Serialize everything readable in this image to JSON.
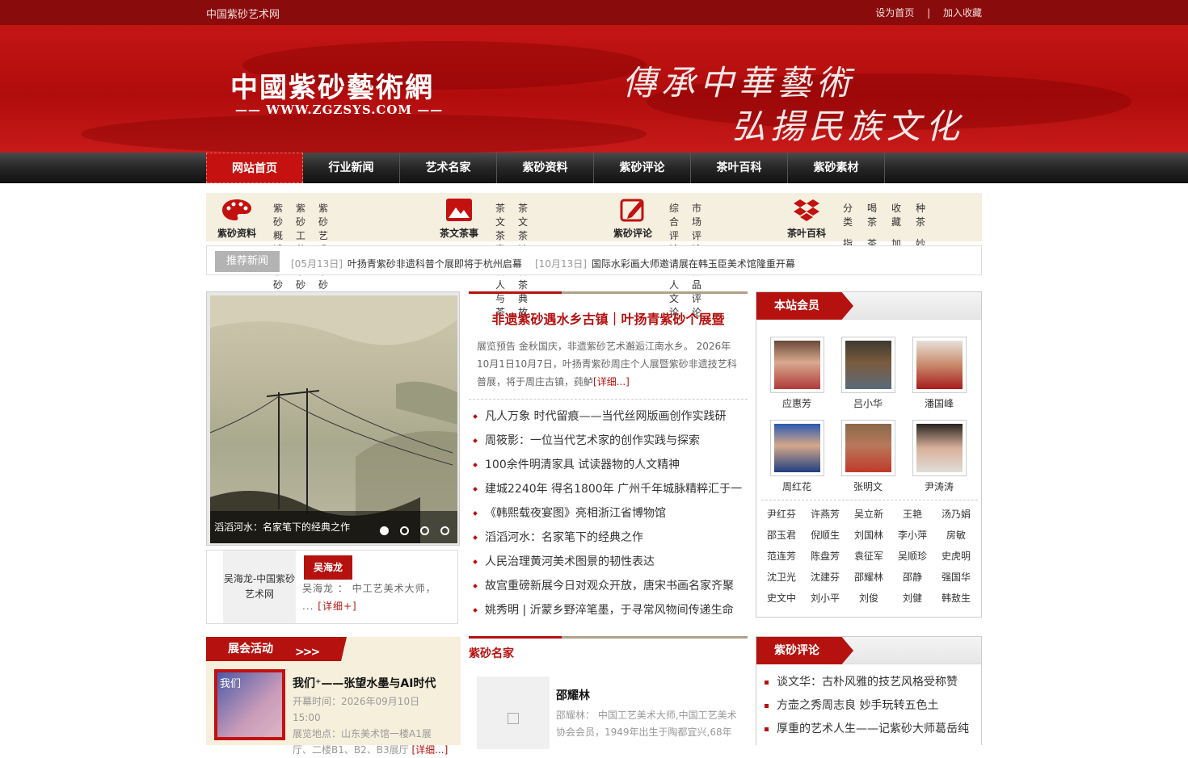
{
  "topbar": {
    "site_name": "中国紫砂艺术网",
    "set_home": "设为首页",
    "separator": "|",
    "add_favorite": "加入收藏"
  },
  "banner": {
    "logo_cn": "中國紫砂藝術網",
    "logo_en": "—— WWW.ZGZSYS.COM ——",
    "slogan_line1": "傳承中華藝術",
    "slogan_line2": "弘揚民族文化"
  },
  "nav": {
    "items": [
      "网站首页",
      "行业新闻",
      "艺术名家",
      "紫砂资料",
      "紫砂评论",
      "茶叶百科",
      "紫砂素材"
    ],
    "active": "网站首页"
  },
  "categories": [
    {
      "label": "紫砂资料",
      "icon": "palette-icon",
      "links": [
        "紫砂概述",
        "紫砂工艺",
        "紫砂艺术",
        "紫砂术语",
        "紫砂材料",
        "紫砂常识"
      ]
    },
    {
      "label": "茶文茶事",
      "icon": "landscape-icon",
      "links": [
        "茶文茶事",
        "茶文茶诗",
        "名人与茶",
        "名茶典故"
      ]
    },
    {
      "label": "紫砂评论",
      "icon": "pen-icon",
      "links": [
        "综合评论",
        "市场评论",
        "个人文论",
        "作品评论"
      ]
    },
    {
      "label": "茶叶百科",
      "icon": "dropbox-icon",
      "links": [
        "分类",
        "喝茶",
        "收藏",
        "种茶",
        "指南",
        "茶场",
        "加工",
        "妙用"
      ]
    }
  ],
  "recommended": {
    "tag": "推荐新闻",
    "items": [
      {
        "date": "[05月13日]",
        "title": "叶扬青紫砂非遗科普个展即将于杭州启幕"
      },
      {
        "date": "[10月13日]",
        "title": "国际水彩画大师邀请展在韩玉臣美术馆隆重开幕"
      }
    ]
  },
  "slideshow": {
    "caption": "滔滔河水：名家笔下的经典之作",
    "dots": 4,
    "active_dot": 1
  },
  "featured_person": {
    "photo_alt": "吴海龙-中国紫砂艺术网",
    "name": "吴海龙",
    "desc": "吴海龙 ： 中工艺美术大师， ...",
    "more": "[详细+]"
  },
  "headline": {
    "title": "非遗紫砂遇水乡古镇｜叶扬青紫砂个展暨",
    "summary": "展览预告 金秋国庆，非遗紫砂艺术邂逅江南水乡。 2026年10月1日10月7日，叶扬青紫砂周庄个人展暨紫砂非遗技艺科普展，将于周庄古镇，莼鲈",
    "more": "[详细...]",
    "list": [
      "凡人万象 时代留痕——当代丝网版画创作实践研",
      "周筱影：一位当代艺术家的创作实践与探索",
      "100余件明清家具 试读器物的人文精神",
      "建城2240年 得名1800年 广州千年城脉精粹汇于一",
      "《韩熙载夜宴图》亮相浙江省博物馆",
      "滔滔河水：名家笔下的经典之作",
      "人民治理黄河美术图景的韧性表达",
      "故宫重磅新展今日对观众开放，唐宋书画名家齐聚",
      "姚秀明 | 沂蒙乡野淬笔墨，于寻常风物间传递生命"
    ]
  },
  "members": {
    "title": "本站会员",
    "featured": [
      "应惠芳",
      "吕小华",
      "潘国峰",
      "周红花",
      "张明文",
      "尹涛涛"
    ],
    "names": [
      "尹红芬",
      "许燕芳",
      "吴立新",
      "王艳",
      "汤乃娟",
      "邵玉君",
      "倪顺生",
      "刘国林",
      "李小萍",
      "房敏",
      "范连芳",
      "陈盘芳",
      "袁征军",
      "吴顺珍",
      "史虎明",
      "沈卫光",
      "沈建芬",
      "邵耀林",
      "邵静",
      "强国华",
      "史文中",
      "刘小平",
      "刘俊",
      "刘健",
      "韩敖生"
    ]
  },
  "exhibition": {
    "title": "展会活动",
    "arrow": ">>>",
    "poster_text": "我们",
    "event_title": "我们⁺——张望水墨与AI时代",
    "open_time": "开幕时间：2026年09月10日 15:00",
    "location": "展览地点：山东美术馆一楼A1展厅、二楼B1、B2、B3展厅",
    "more": "[详细...]"
  },
  "masters": {
    "title": "紫砂名家",
    "name": "邵耀林",
    "desc": "邵耀林： 中国工艺美术大师,中国工艺美术协会会员，1949年出生于陶都宜兴,68年"
  },
  "reviews": {
    "title": "紫砂评论",
    "list": [
      "谈文华：古朴风雅的技艺风格受称赞",
      "方壶之秀周志良 妙手玩转五色土",
      "厚重的艺术人生——记紫砂大师葛岳纯"
    ]
  },
  "colors": {
    "brand_red": "#b5120f",
    "top_bar": "#8a0b0b",
    "nav_dark": "#262626",
    "cat_bg": "#f5efe0"
  }
}
